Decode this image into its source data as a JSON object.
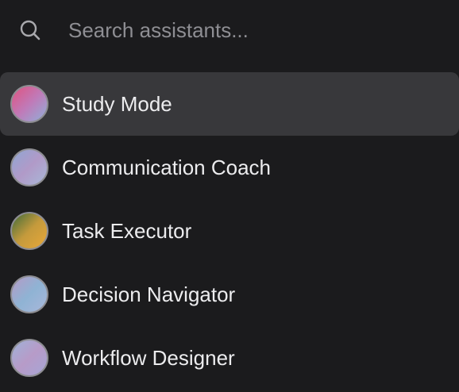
{
  "search": {
    "placeholder": "Search assistants...",
    "value": "",
    "icon": "search-icon"
  },
  "assistants": [
    {
      "label": "Study Mode",
      "selected": true,
      "avatar_colors": [
        "#e0527f",
        "#c07ab8",
        "#8fb0d9"
      ]
    },
    {
      "label": "Communication Coach",
      "selected": false,
      "avatar_colors": [
        "#8fa6d3",
        "#b19ac8",
        "#a8b8d8"
      ]
    },
    {
      "label": "Task Executor",
      "selected": false,
      "avatar_colors": [
        "#3f6b3a",
        "#c49a3c",
        "#e8a83a"
      ]
    },
    {
      "label": "Decision Navigator",
      "selected": false,
      "avatar_colors": [
        "#b59ac6",
        "#8fb3d4",
        "#a9b7da"
      ]
    },
    {
      "label": "Workflow Designer",
      "selected": false,
      "avatar_colors": [
        "#9fb2d8",
        "#b79bc8",
        "#a6a6d6"
      ]
    }
  ]
}
